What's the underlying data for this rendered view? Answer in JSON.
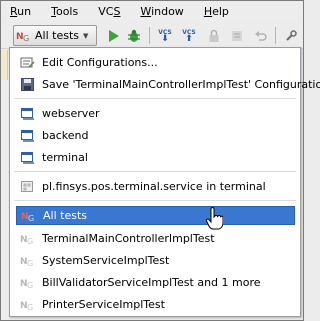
{
  "menubar": {
    "items": [
      {
        "pre": "",
        "mn": "R",
        "post": "un"
      },
      {
        "pre": "",
        "mn": "T",
        "post": "ools"
      },
      {
        "pre": "VC",
        "mn": "S",
        "post": ""
      },
      {
        "pre": "",
        "mn": "W",
        "post": "indow"
      },
      {
        "pre": "",
        "mn": "H",
        "post": "elp"
      }
    ]
  },
  "toolbar": {
    "run_config_label": "All tests",
    "vcs_label": "VCS"
  },
  "dropdown": {
    "edit_configurations": "Edit Configurations...",
    "save_configuration": "Save 'TerminalMainControllerImplTest' Configuration",
    "modules": [
      "webserver",
      "backend",
      "terminal"
    ],
    "package_config": "pl.finsys.pos.terminal.service in terminal",
    "tests": [
      {
        "label": "All tests",
        "selected": true
      },
      {
        "label": "TerminalMainControllerImplTest",
        "selected": false
      },
      {
        "label": "SystemServiceImplTest",
        "selected": false
      },
      {
        "label": "BillValidatorServiceImplTest and 1 more",
        "selected": false
      },
      {
        "label": "PrinterServiceImplTest",
        "selected": false
      }
    ]
  },
  "colors": {
    "selection": "#3a77d1",
    "run_green": "#3aa63a",
    "vcs_blue": "#2b5ea8",
    "junit_red": "#c84a3a"
  }
}
